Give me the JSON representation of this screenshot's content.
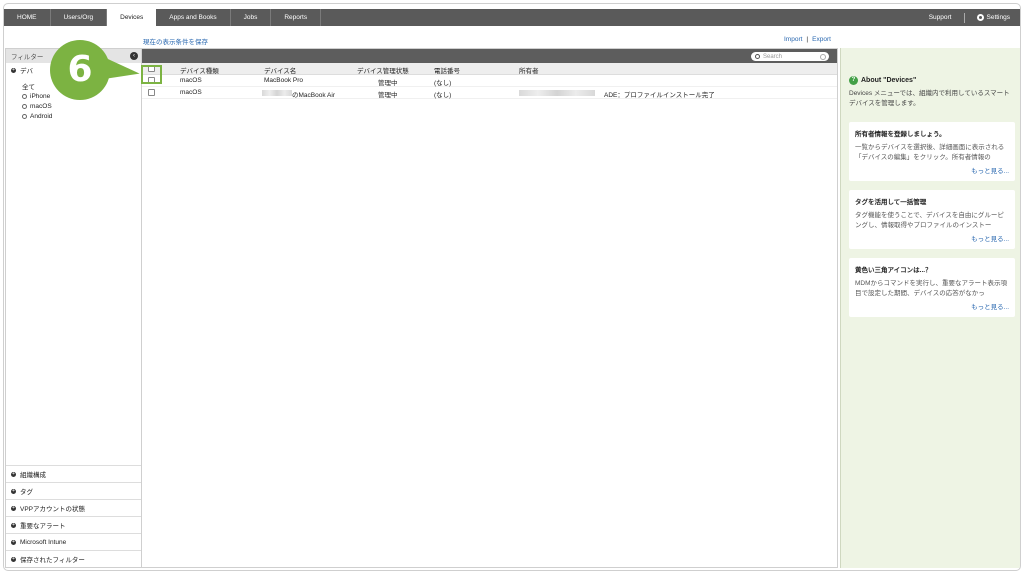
{
  "nav": {
    "tabs": [
      "HOME",
      "Users/Org",
      "Devices",
      "Apps and Books",
      "Jobs",
      "Reports"
    ],
    "active": "Devices",
    "support": "Support",
    "settings": "Settings"
  },
  "actions": {
    "save_view": "現在の表示条件を保存",
    "import": "Import",
    "separator": "|",
    "export": "Export"
  },
  "sidebar": {
    "filter_header": "フィルター",
    "device_section": "デバ",
    "device_options": [
      "全て",
      "iPhone",
      "macOS",
      "Android"
    ],
    "bottom_sections": [
      "組織構成",
      "タグ",
      "VPPアカウントの状態",
      "重要なアラート",
      "Microsoft Intune",
      "保存されたフィルター"
    ]
  },
  "grid": {
    "search_placeholder": "Search",
    "columns": [
      "デバイス種類",
      "デバイス名",
      "デバイス管理状態",
      "電話番号",
      "所有者"
    ],
    "rows": [
      {
        "type": "macOS",
        "name": "MacBook Pro",
        "status": "管理中",
        "phone": "(なし)",
        "owner": "",
        "note": ""
      },
      {
        "type": "macOS",
        "name": "のMacBook Air",
        "status": "管理中",
        "phone": "(なし)",
        "owner": "",
        "note": "ADE：プロファイルインストール完了"
      }
    ]
  },
  "callout": {
    "step": "6",
    "color": "#7cb342"
  },
  "right_panel": {
    "about_title": "About \"Devices\"",
    "about_desc": "Devices メニューでは、組織内で利用しているスマートデバイスを管理します。",
    "cards": [
      {
        "title": "所有者情報を登録しましょう。",
        "desc": "一覧からデバイスを選択後、詳細画面に表示される「デバイスの編集」をクリック。所有者情報の",
        "more": "もっと見る..."
      },
      {
        "title": "タグを活用して一括管理",
        "desc": "タグ機能を使うことで、デバイスを自由にグルーピングし、情報取得やプロファイルのインストー",
        "more": "もっと見る..."
      },
      {
        "title": "黄色い三角アイコンは...？",
        "desc": "MDMからコマンドを実行し、重要なアラート表示項目で設定した期間、デバイスの応答がなかっ",
        "more": "もっと見る..."
      }
    ]
  }
}
